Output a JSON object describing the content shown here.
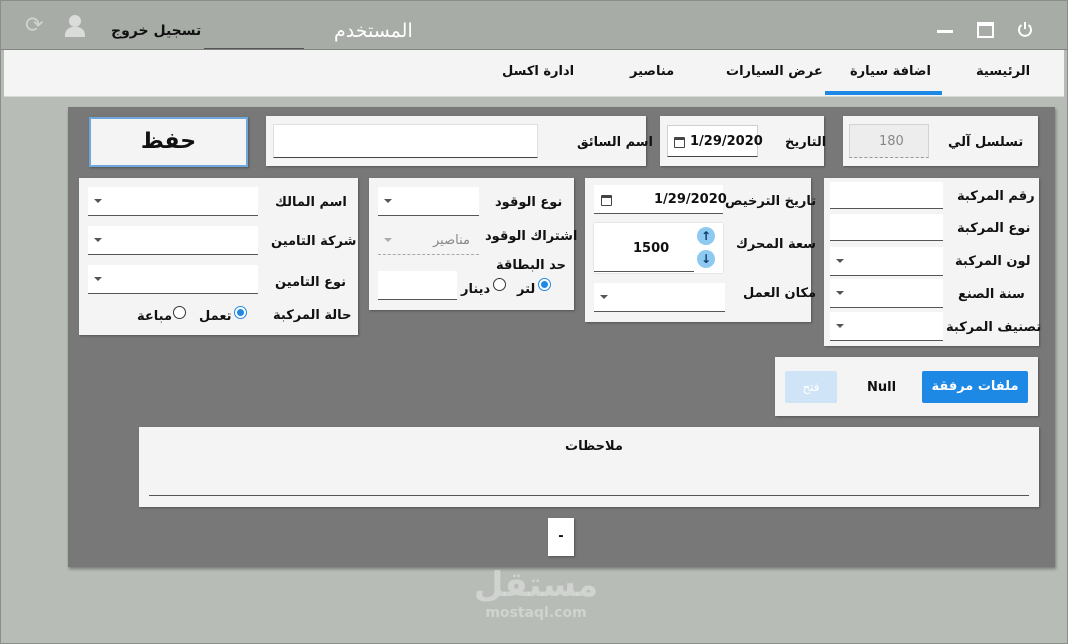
{
  "titlebar": {
    "title": "المستخدم",
    "logout_label": "تسجيل خروج"
  },
  "nav": {
    "tabs": [
      "الرئيسية",
      "اضافة سيارة",
      "عرض السيارات",
      "مناصير",
      "ادارة اكسل"
    ],
    "active_index": 1
  },
  "header": {
    "serial_label": "تسلسل آلي",
    "serial_value": "180",
    "date_label": "التاريخ",
    "date_value": "1/29/2020",
    "driver_label": "اسم السائق",
    "save_label": "حفظ"
  },
  "vehicle": {
    "plate_label": "رقم المركبة",
    "type_label": "نوع المركبة",
    "color_label": "لون المركبة",
    "year_label": "سنة الصنع",
    "class_label": "تصنيف المركبة"
  },
  "license": {
    "license_date_label": "تاريخ الترخيص",
    "license_date_value": "1/29/2020",
    "engine_label": "سعة المحرك",
    "engine_value": "1500",
    "workplace_label": "مكان العمل"
  },
  "fuel": {
    "fuel_type_label": "نوع الوقود",
    "fuel_sub_label": "اشتراك الوقود",
    "fuel_sub_value": "مناصير",
    "card_limit_label": "حد البطاقة",
    "liter_label": "لتر",
    "dinar_label": "دينار",
    "unit_selected": "لتر"
  },
  "owner": {
    "owner_label": "اسم المالك",
    "insurer_label": "شركة التامين",
    "insurance_type_label": "نوع التامين",
    "status_label": "حالة المركبة",
    "working_label": "تعمل",
    "sold_label": "مباعة",
    "status_selected": "تعمل"
  },
  "attachments": {
    "button_label": "ملفات مرفقة",
    "value": "Null",
    "open_label": "فتح"
  },
  "notes": {
    "label": "ملاحظات"
  },
  "footer": {
    "small_button": "-"
  },
  "watermark": {
    "text": "مستقل",
    "sub": "mostaql.com"
  },
  "colors": {
    "accent": "#1e88e5",
    "titlebar": "#a7aca6",
    "panel": "#777877",
    "card": "#f4f4f4"
  }
}
